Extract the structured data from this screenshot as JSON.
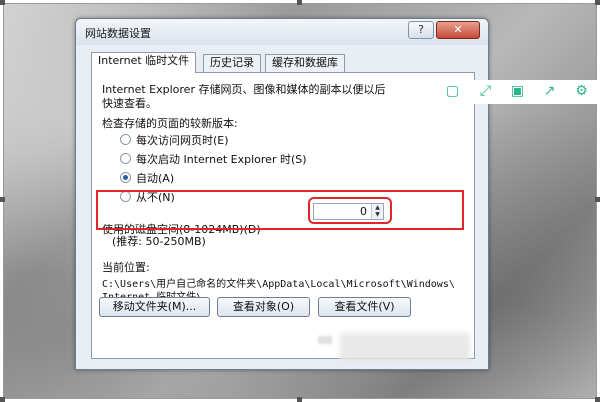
{
  "dialog": {
    "title": "网站数据设置",
    "help_label": "?",
    "close_label": "✕"
  },
  "tabs": [
    {
      "label": "Internet 临时文件",
      "active": true
    },
    {
      "label": "历史记录",
      "active": false
    },
    {
      "label": "缓存和数据库",
      "active": false
    }
  ],
  "panel": {
    "description_line1": "Internet Explorer 存储网页、图像和媒体的副本以便以后",
    "description_line2": "快速查看。",
    "check_label": "检查存储的页面的较新版本:",
    "options": [
      {
        "label": "每次访问网页时(E)",
        "checked": false
      },
      {
        "label": "每次启动 Internet Explorer 时(S)",
        "checked": false
      },
      {
        "label": "自动(A)",
        "checked": true
      },
      {
        "label": "从不(N)",
        "checked": false
      }
    ],
    "disk_space_label": "使用的磁盘空间(8-1024MB)(D)",
    "disk_space_hint": "(推荐: 50-250MB)",
    "disk_space_value": "0",
    "current_location_label": "当前位置:",
    "path_line1": "C:\\Users\\用户自己命名的文件夹\\AppData\\Local\\Microsoft\\Windows\\",
    "path_line2": "Internet 临时文件\\",
    "buttons": {
      "move_folder": "移动文件夹(M)...",
      "view_objects": "查看对象(O)",
      "view_files": "查看文件(V)"
    }
  },
  "toolbar": {
    "icons": [
      "crop-icon",
      "fullscreen-icon",
      "save-icon",
      "share-icon",
      "settings-icon"
    ]
  },
  "colors": {
    "highlight": "#e0262a",
    "toolbar_icon": "#2bb58a"
  }
}
